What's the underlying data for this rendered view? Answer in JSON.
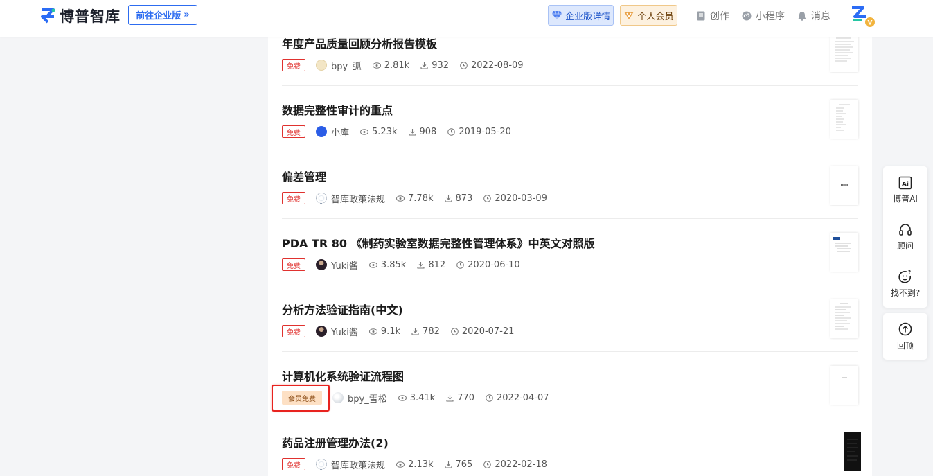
{
  "header": {
    "logo_text": "博普智库",
    "enterprise_btn": "前往企业版",
    "enterprise_detail": "企业版详情",
    "vip": "个人会员",
    "create": "创作",
    "miniprogram": "小程序",
    "messages": "消息"
  },
  "items": [
    {
      "title": "年度产品质量回顾分析报告模板",
      "tag": "免费",
      "author": "bpy_弧",
      "views": "2.81k",
      "downloads": "932",
      "date": "2022-08-09"
    },
    {
      "title": "数据完整性审计的重点",
      "tag": "免费",
      "author": "小库",
      "views": "5.23k",
      "downloads": "908",
      "date": "2019-05-20"
    },
    {
      "title": "偏差管理",
      "tag": "免费",
      "author": "智库政策法规",
      "views": "7.78k",
      "downloads": "873",
      "date": "2020-03-09"
    },
    {
      "title": "PDA TR 80 《制药实验室数据完整性管理体系》中英文对照版",
      "tag": "免费",
      "author": "Yuki酱",
      "views": "3.85k",
      "downloads": "812",
      "date": "2020-06-10"
    },
    {
      "title": "分析方法验证指南(中文)",
      "tag": "免费",
      "author": "Yuki酱",
      "views": "9.1k",
      "downloads": "782",
      "date": "2020-07-21"
    },
    {
      "title": "计算机化系统验证流程图",
      "tag": "会员免费",
      "author": "bpy_雪松",
      "views": "3.41k",
      "downloads": "770",
      "date": "2022-04-07"
    },
    {
      "title": "药品注册管理办法(2)",
      "tag": "免费",
      "author": "智库政策法规",
      "views": "2.13k",
      "downloads": "765",
      "date": "2022-02-18"
    }
  ],
  "side": {
    "ai": "博普AI",
    "consult": "顾问",
    "notfound": "找不到?",
    "top": "回顶"
  }
}
